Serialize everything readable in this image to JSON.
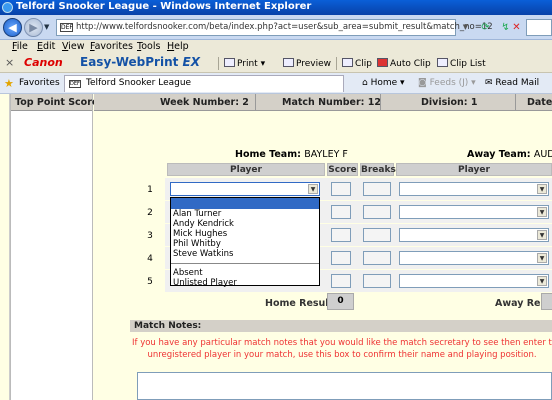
{
  "window": {
    "title": "Telford Snooker League - Windows Internet Explorer",
    "url": "http://www.telfordsnooker.com/beta/index.php?act=user&sub_area=submit_result&match_no=12",
    "page_icon_text": "DEF"
  },
  "menu": [
    "File",
    "Edit",
    "View",
    "Favorites",
    "Tools",
    "Help"
  ],
  "canon": {
    "brand": "Canon",
    "product_main": "Easy-WebPrint ",
    "product_ex": "EX",
    "print": "Print",
    "preview": "Preview",
    "clip": "Clip",
    "auto_clip": "Auto Clip",
    "clip_list": "Clip List"
  },
  "favbar": {
    "favorites": "Favorites",
    "tab_title": "Telford Snooker League",
    "home": "Home",
    "feeds": "Feeds (J)",
    "read_mail": "Read Mail"
  },
  "sidebar": {
    "header": "Top Point Scorers"
  },
  "match": {
    "week": "Week Number: 2",
    "match_no": "Match Number: 12",
    "division": "Division: 1",
    "date": "Date: W"
  },
  "teams": {
    "home_label": "Home Team: ",
    "home_name": "BAYLEY F",
    "away_label": "Away Team: ",
    "away_name": "AUDCO C"
  },
  "table": {
    "player": "Player",
    "score": "Score",
    "breaks": "Breaks",
    "rows": [
      "1",
      "2",
      "3",
      "4",
      "5"
    ]
  },
  "dropdown": {
    "players": [
      "Alan Turner",
      "Andy Kendrick",
      "Mick Hughes",
      "Phil Whitby",
      "Steve Watkins"
    ],
    "extras": [
      "Absent",
      "Unlisted Player"
    ]
  },
  "results": {
    "home_label": "Home Result:",
    "home_value": "0",
    "away_label": "Away Result:"
  },
  "notes": {
    "header": "Match Notes:",
    "line1": "If you have any particular match notes that you would like the match secretary to see then enter them here. Also, r",
    "line2": "unregistered player in your match, use this box to confirm their name and playing position."
  }
}
